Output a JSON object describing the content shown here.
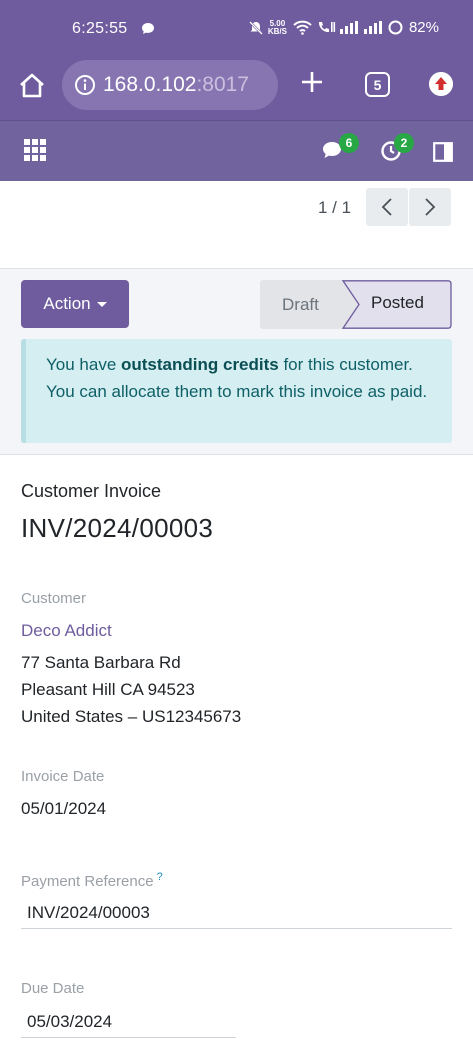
{
  "status_bar": {
    "time": "6:25:55",
    "net_speed_value": "5.00",
    "net_speed_unit": "KB/S",
    "battery": "82%"
  },
  "browser": {
    "url_host": "168.0.102",
    "url_port": ":8017",
    "tab_count": "5"
  },
  "odoo_nav": {
    "messages_badge": "6",
    "activities_badge": "2"
  },
  "pager": {
    "value": "1 / 1"
  },
  "control": {
    "action_label": "Action",
    "states": [
      "Draft",
      "Posted"
    ],
    "active_state": "Posted"
  },
  "alert": {
    "prefix": "You have ",
    "bold": "outstanding credits",
    "suffix": " for this customer. You can allocate them to mark this invoice as paid."
  },
  "form": {
    "subtitle": "Customer Invoice",
    "number": "INV/2024/00003",
    "customer_label": "Customer",
    "customer_name": "Deco Addict",
    "address": [
      "77 Santa Barbara Rd",
      "Pleasant Hill CA 94523",
      "United States – US12345673"
    ],
    "invoice_date_label": "Invoice Date",
    "invoice_date": "05/01/2024",
    "payment_reference_label": "Payment Reference",
    "payment_reference_help": "?",
    "payment_reference": "INV/2024/00003",
    "due_date_label": "Due Date",
    "due_date": "05/03/2024"
  },
  "colors": {
    "brand": "#71639e",
    "badge": "#28a745",
    "alert_bg": "#d4eef1",
    "link": "#6f5c9e"
  }
}
